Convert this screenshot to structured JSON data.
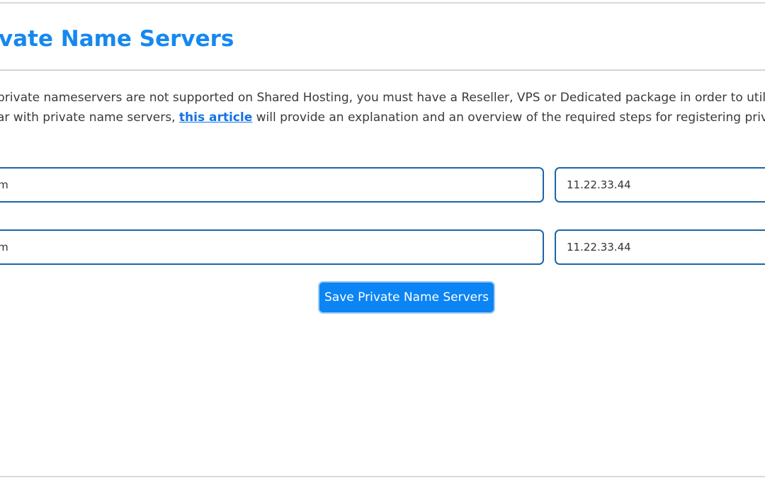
{
  "page": {
    "title": "Private Name Servers",
    "title_visible": "vate Name Servers"
  },
  "description": {
    "line1": "private nameservers are not supported on Shared Hosting, you must have a Reseller, VPS or Dedicated package in order to utiliz",
    "line2_before": "ar with private name servers, ",
    "link_text": "this article",
    "line2_after": " will provide an explanation and an overview of the required steps for registering privat"
  },
  "nameservers": [
    {
      "hostname_value": "om",
      "ip_value": "11.22.33.44"
    },
    {
      "hostname_value": "om",
      "ip_value": "11.22.33.44"
    }
  ],
  "save_button": {
    "label": "Save Private Name Servers"
  },
  "colors": {
    "accent": "#1588f0",
    "link": "#1473e6",
    "button": "#0b84f4",
    "input_border": "#1e65a5"
  }
}
